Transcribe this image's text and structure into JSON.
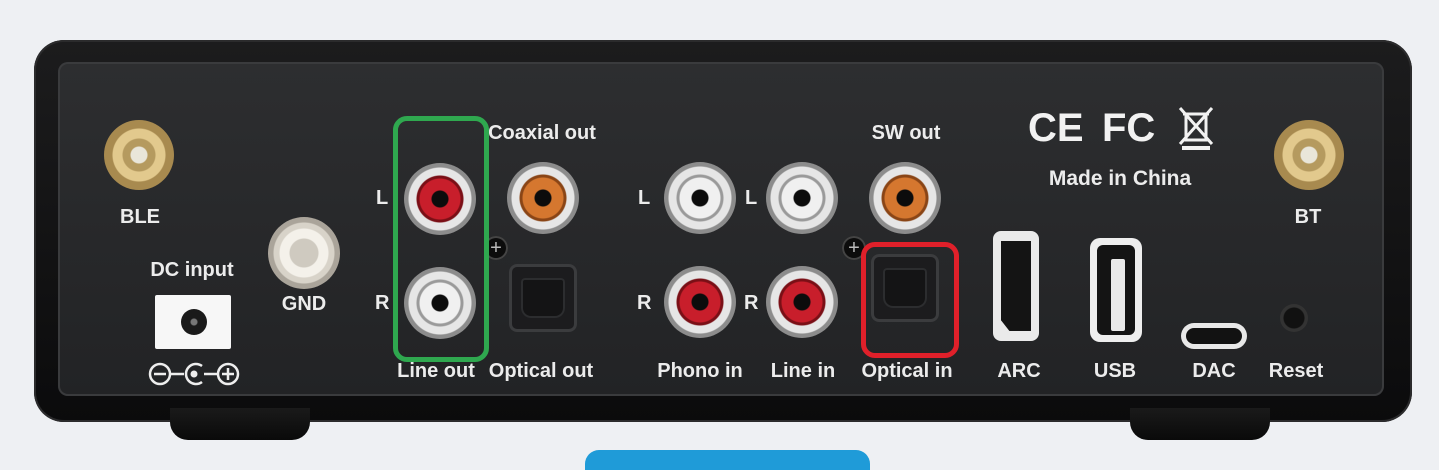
{
  "labels": {
    "ble": "BLE",
    "bt": "BT",
    "dc_input": "DC input",
    "gnd": "GND",
    "line_out_l": "L",
    "line_out_r": "R",
    "coaxial_out": "Coaxial out",
    "line_out": "Line out",
    "optical_out": "Optical out",
    "phono_l": "L",
    "phono_r": "R",
    "line_in_l": "L",
    "line_in_r": "R",
    "phono_in": "Phono in",
    "line_in": "Line in",
    "sw_out": "SW out",
    "optical_in": "Optical in",
    "arc": "ARC",
    "usb": "USB",
    "dac": "DAC",
    "reset": "Reset",
    "made_in": "Made in China",
    "ce": "CE",
    "fc": "FC"
  },
  "colors": {
    "highlight_green": "#2fa84f",
    "highlight_red": "#e0202a",
    "rca_red": "#c81e2b",
    "rca_white": "#e8e8e8",
    "rca_orange": "#d5772f",
    "gold": "#e2c98d",
    "button_blue": "#1f9bd8"
  }
}
